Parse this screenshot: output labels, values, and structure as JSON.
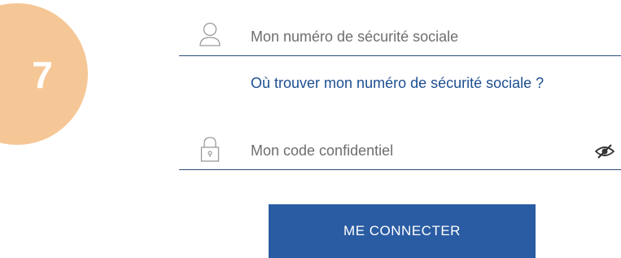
{
  "step": {
    "number": "7",
    "color": "#f6c796"
  },
  "ssn_field": {
    "placeholder": "Mon numéro de sécurité sociale",
    "icon": "user-icon"
  },
  "help_link": {
    "label": "Où trouver mon numéro de sécurité sociale ?",
    "color": "#1d4f91"
  },
  "code_field": {
    "placeholder": "Mon code confidentiel",
    "icon": "lock-icon",
    "toggle_icon": "eye-slash-icon"
  },
  "connect_button": {
    "label": "ME CONNECTER",
    "color": "#2a5ca3"
  }
}
